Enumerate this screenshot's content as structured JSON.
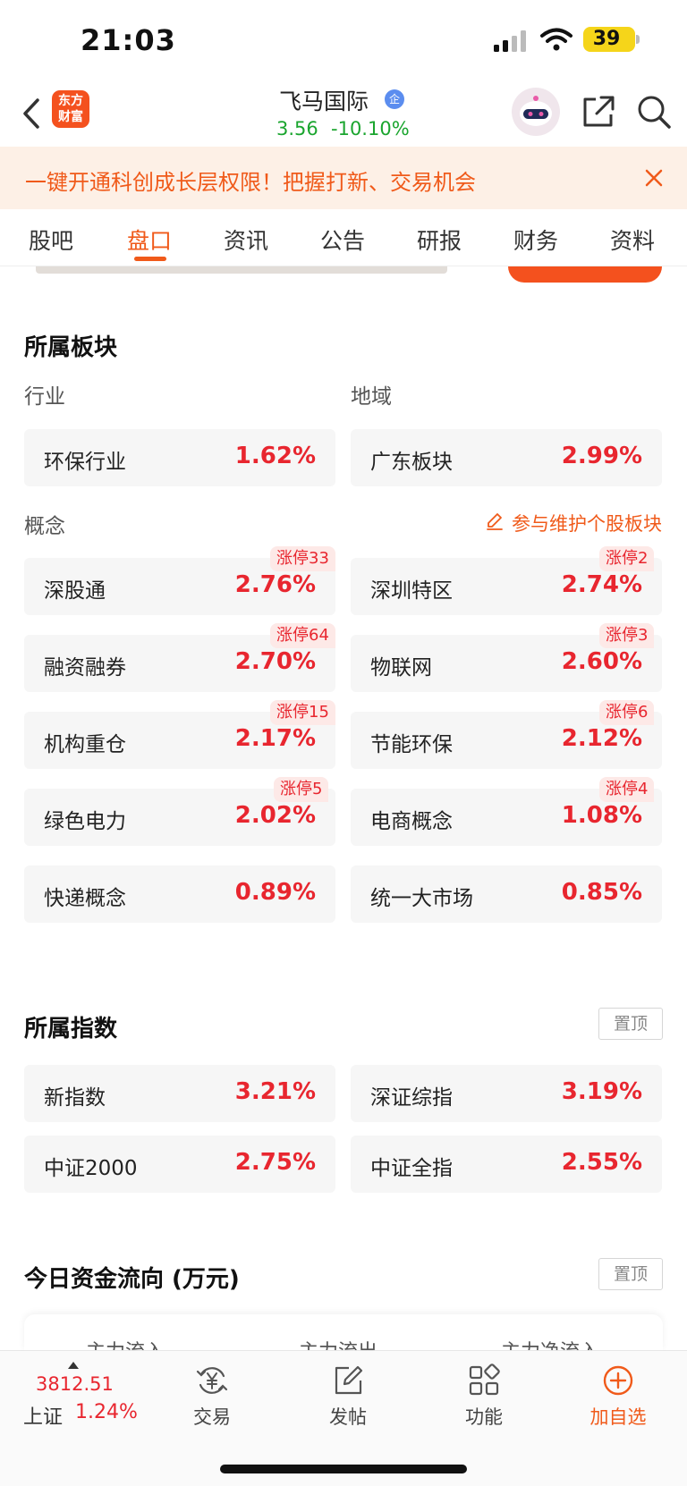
{
  "status_bar": {
    "time": "21:03",
    "battery": "39"
  },
  "header": {
    "logo_line1": "东方",
    "logo_line2": "财富",
    "stock_name": "飞马国际",
    "badge": "企",
    "price": "3.56",
    "change": "-10.10%"
  },
  "promo": {
    "text": "一键开通科创成长层权限！把握打新、交易机会"
  },
  "tabs": [
    {
      "label": "股吧"
    },
    {
      "label": "盘口"
    },
    {
      "label": "资讯"
    },
    {
      "label": "公告"
    },
    {
      "label": "研报"
    },
    {
      "label": "财务"
    },
    {
      "label": "资料"
    }
  ],
  "sectors": {
    "title": "所属板块",
    "industry_label": "行业",
    "region_label": "地域",
    "industry": {
      "name": "环保行业",
      "pct": "1.62%"
    },
    "region": {
      "name": "广东板块",
      "pct": "2.99%"
    },
    "concept_label": "概念",
    "maintain_link": "参与维护个股板块",
    "concepts": [
      {
        "name": "深股通",
        "pct": "2.76%",
        "limit": "涨停33"
      },
      {
        "name": "深圳特区",
        "pct": "2.74%",
        "limit": "涨停2"
      },
      {
        "name": "融资融券",
        "pct": "2.70%",
        "limit": "涨停64"
      },
      {
        "name": "物联网",
        "pct": "2.60%",
        "limit": "涨停3"
      },
      {
        "name": "机构重仓",
        "pct": "2.17%",
        "limit": "涨停15"
      },
      {
        "name": "节能环保",
        "pct": "2.12%",
        "limit": "涨停6"
      },
      {
        "name": "绿色电力",
        "pct": "2.02%",
        "limit": "涨停5"
      },
      {
        "name": "电商概念",
        "pct": "1.08%",
        "limit": "涨停4"
      },
      {
        "name": "快递概念",
        "pct": "0.89%",
        "limit": ""
      },
      {
        "name": "统一大市场",
        "pct": "0.85%",
        "limit": ""
      }
    ]
  },
  "indices": {
    "title": "所属指数",
    "pin_label": "置顶",
    "items": [
      {
        "name": "新指数",
        "pct": "3.21%"
      },
      {
        "name": "深证综指",
        "pct": "3.19%"
      },
      {
        "name": "中证2000",
        "pct": "2.75%"
      },
      {
        "name": "中证全指",
        "pct": "2.55%"
      }
    ]
  },
  "fund_flow": {
    "title": "今日资金流向 (万元)",
    "pin_label": "置顶",
    "columns": [
      "主力流入",
      "主力流出",
      "主力净流入"
    ]
  },
  "bottom_bar": {
    "index_value": "3812.51",
    "index_name": "上证",
    "index_pct": "1.24%",
    "nav": [
      {
        "label": "交易",
        "icon": "yuan-exchange-icon"
      },
      {
        "label": "发帖",
        "icon": "edit-post-icon"
      },
      {
        "label": "功能",
        "icon": "grid-icon"
      },
      {
        "label": "加自选",
        "icon": "add-circle-icon"
      }
    ]
  },
  "colors": {
    "accent": "#f05a1a",
    "up": "#e8262f",
    "down": "#1aa52e"
  }
}
